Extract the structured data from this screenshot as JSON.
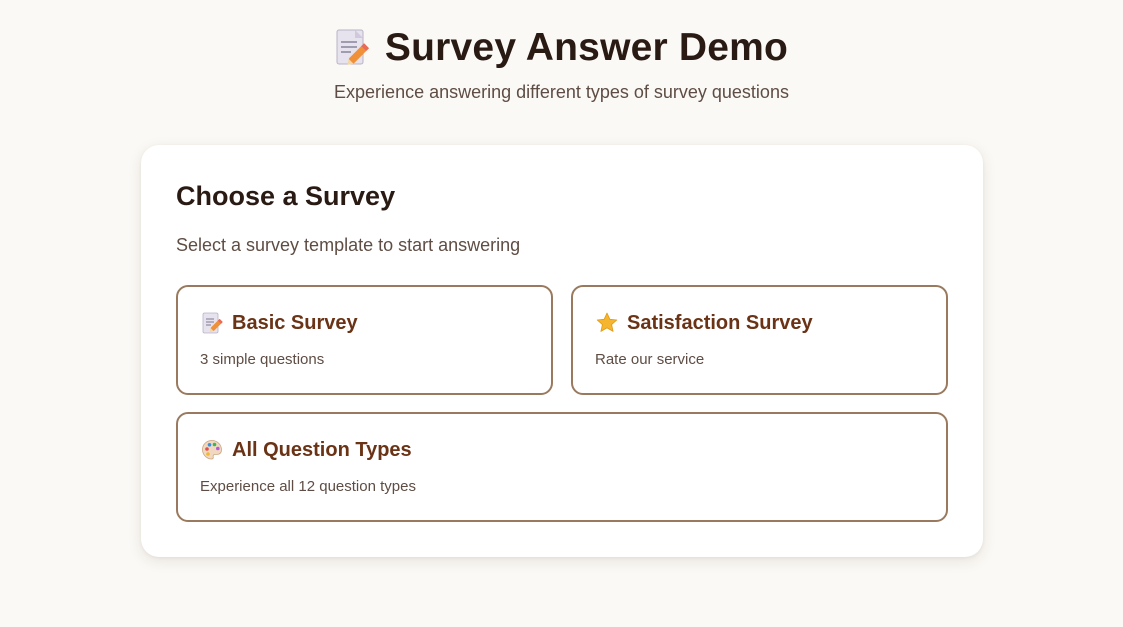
{
  "header": {
    "title": "Survey Answer Demo",
    "title_icon": "memo-icon",
    "subtitle": "Experience answering different types of survey questions"
  },
  "card": {
    "title": "Choose a Survey",
    "subtitle": "Select a survey template to start answering",
    "options": [
      {
        "icon": "memo-icon",
        "name": "Basic Survey",
        "description": "3 simple questions"
      },
      {
        "icon": "star-icon",
        "name": "Satisfaction Survey",
        "description": "Rate our service"
      },
      {
        "icon": "palette-icon",
        "name": "All Question Types",
        "description": "Experience all 12 question types"
      }
    ]
  },
  "colors": {
    "background": "#fbf9f5",
    "card": "#ffffff",
    "option_border": "#9a7a5e",
    "option_title": "#6a3316",
    "heading": "#2a1a14",
    "muted": "#5e4d44",
    "star": "#f5b52e"
  }
}
